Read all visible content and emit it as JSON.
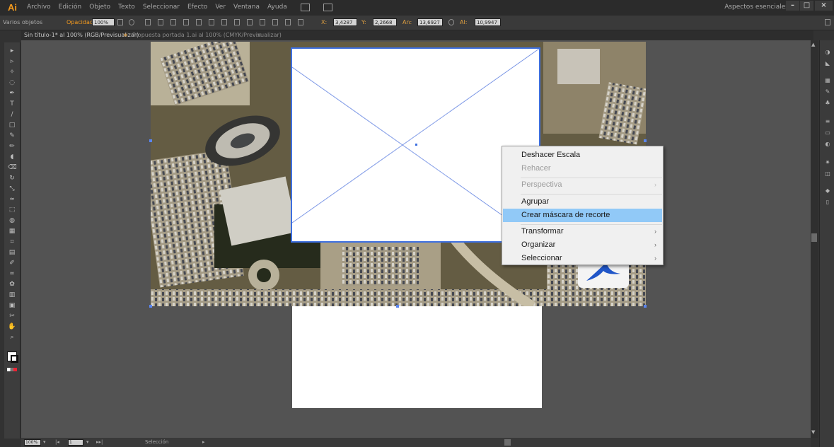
{
  "app": {
    "logo": "Ai",
    "workspace": "Aspectos esenciales",
    "menu": [
      "Archivo",
      "Edición",
      "Objeto",
      "Texto",
      "Seleccionar",
      "Efecto",
      "Ver",
      "Ventana",
      "Ayuda"
    ],
    "window_controls": [
      "–",
      "□",
      "×"
    ]
  },
  "control_bar": {
    "selection_label": "Varios objetos",
    "opacity_label": "Opacidad:",
    "opacity_value": "100%",
    "x_label": "X:",
    "x_value": "3,4287 in",
    "y_label": "Y:",
    "y_value": "2,2668 in",
    "w_label": "An:",
    "w_value": "13,6927 in",
    "h_label": "Al:",
    "h_value": "10,9947 in"
  },
  "tabs": [
    {
      "label": "Sin título-1* al 100% (RGB/Previsualizar)",
      "active": true
    },
    {
      "label": "Propuesta portada 1.ai al 100% (CMYK/Previsualizar)",
      "active": false
    }
  ],
  "context_menu": {
    "items": [
      {
        "label": "Deshacer Escala",
        "disabled": false,
        "submenu": false,
        "highlighted": false
      },
      {
        "label": "Rehacer",
        "disabled": true,
        "submenu": false,
        "highlighted": false
      },
      {
        "label": "Perspectiva",
        "disabled": true,
        "submenu": true,
        "highlighted": false
      },
      {
        "label": "Agrupar",
        "disabled": false,
        "submenu": false,
        "highlighted": false
      },
      {
        "label": "Crear máscara de recorte",
        "disabled": false,
        "submenu": false,
        "highlighted": true
      },
      {
        "label": "Transformar",
        "disabled": false,
        "submenu": true,
        "highlighted": false
      },
      {
        "label": "Organizar",
        "disabled": false,
        "submenu": true,
        "highlighted": false
      },
      {
        "label": "Seleccionar",
        "disabled": false,
        "submenu": true,
        "highlighted": false
      }
    ],
    "arrow": "›"
  },
  "status_bar": {
    "zoom": "100%",
    "artboard_number": "1",
    "tool": "Selección"
  },
  "tools": [
    "selection-tool-icon",
    "direct-selection-tool-icon",
    "magic-wand-tool-icon",
    "lasso-tool-icon",
    "pen-tool-icon",
    "type-tool-icon",
    "line-tool-icon",
    "rectangle-tool-icon",
    "paintbrush-tool-icon",
    "pencil-tool-icon",
    "blob-brush-tool-icon",
    "eraser-tool-icon",
    "rotate-tool-icon",
    "scale-tool-icon",
    "warp-tool-icon",
    "free-transform-tool-icon",
    "shape-builder-tool-icon",
    "perspective-grid-tool-icon",
    "mesh-tool-icon",
    "gradient-tool-icon",
    "eyedropper-tool-icon",
    "blend-tool-icon",
    "symbol-sprayer-tool-icon",
    "column-graph-tool-icon",
    "artboard-tool-icon",
    "slice-tool-icon",
    "hand-tool-icon",
    "zoom-tool-icon"
  ],
  "colors": {
    "accent_blue": "#3d6fe0",
    "menu_highlight": "#91c9f7",
    "ai_orange": "#f39a1e",
    "logo_blue": "#2056c8"
  }
}
